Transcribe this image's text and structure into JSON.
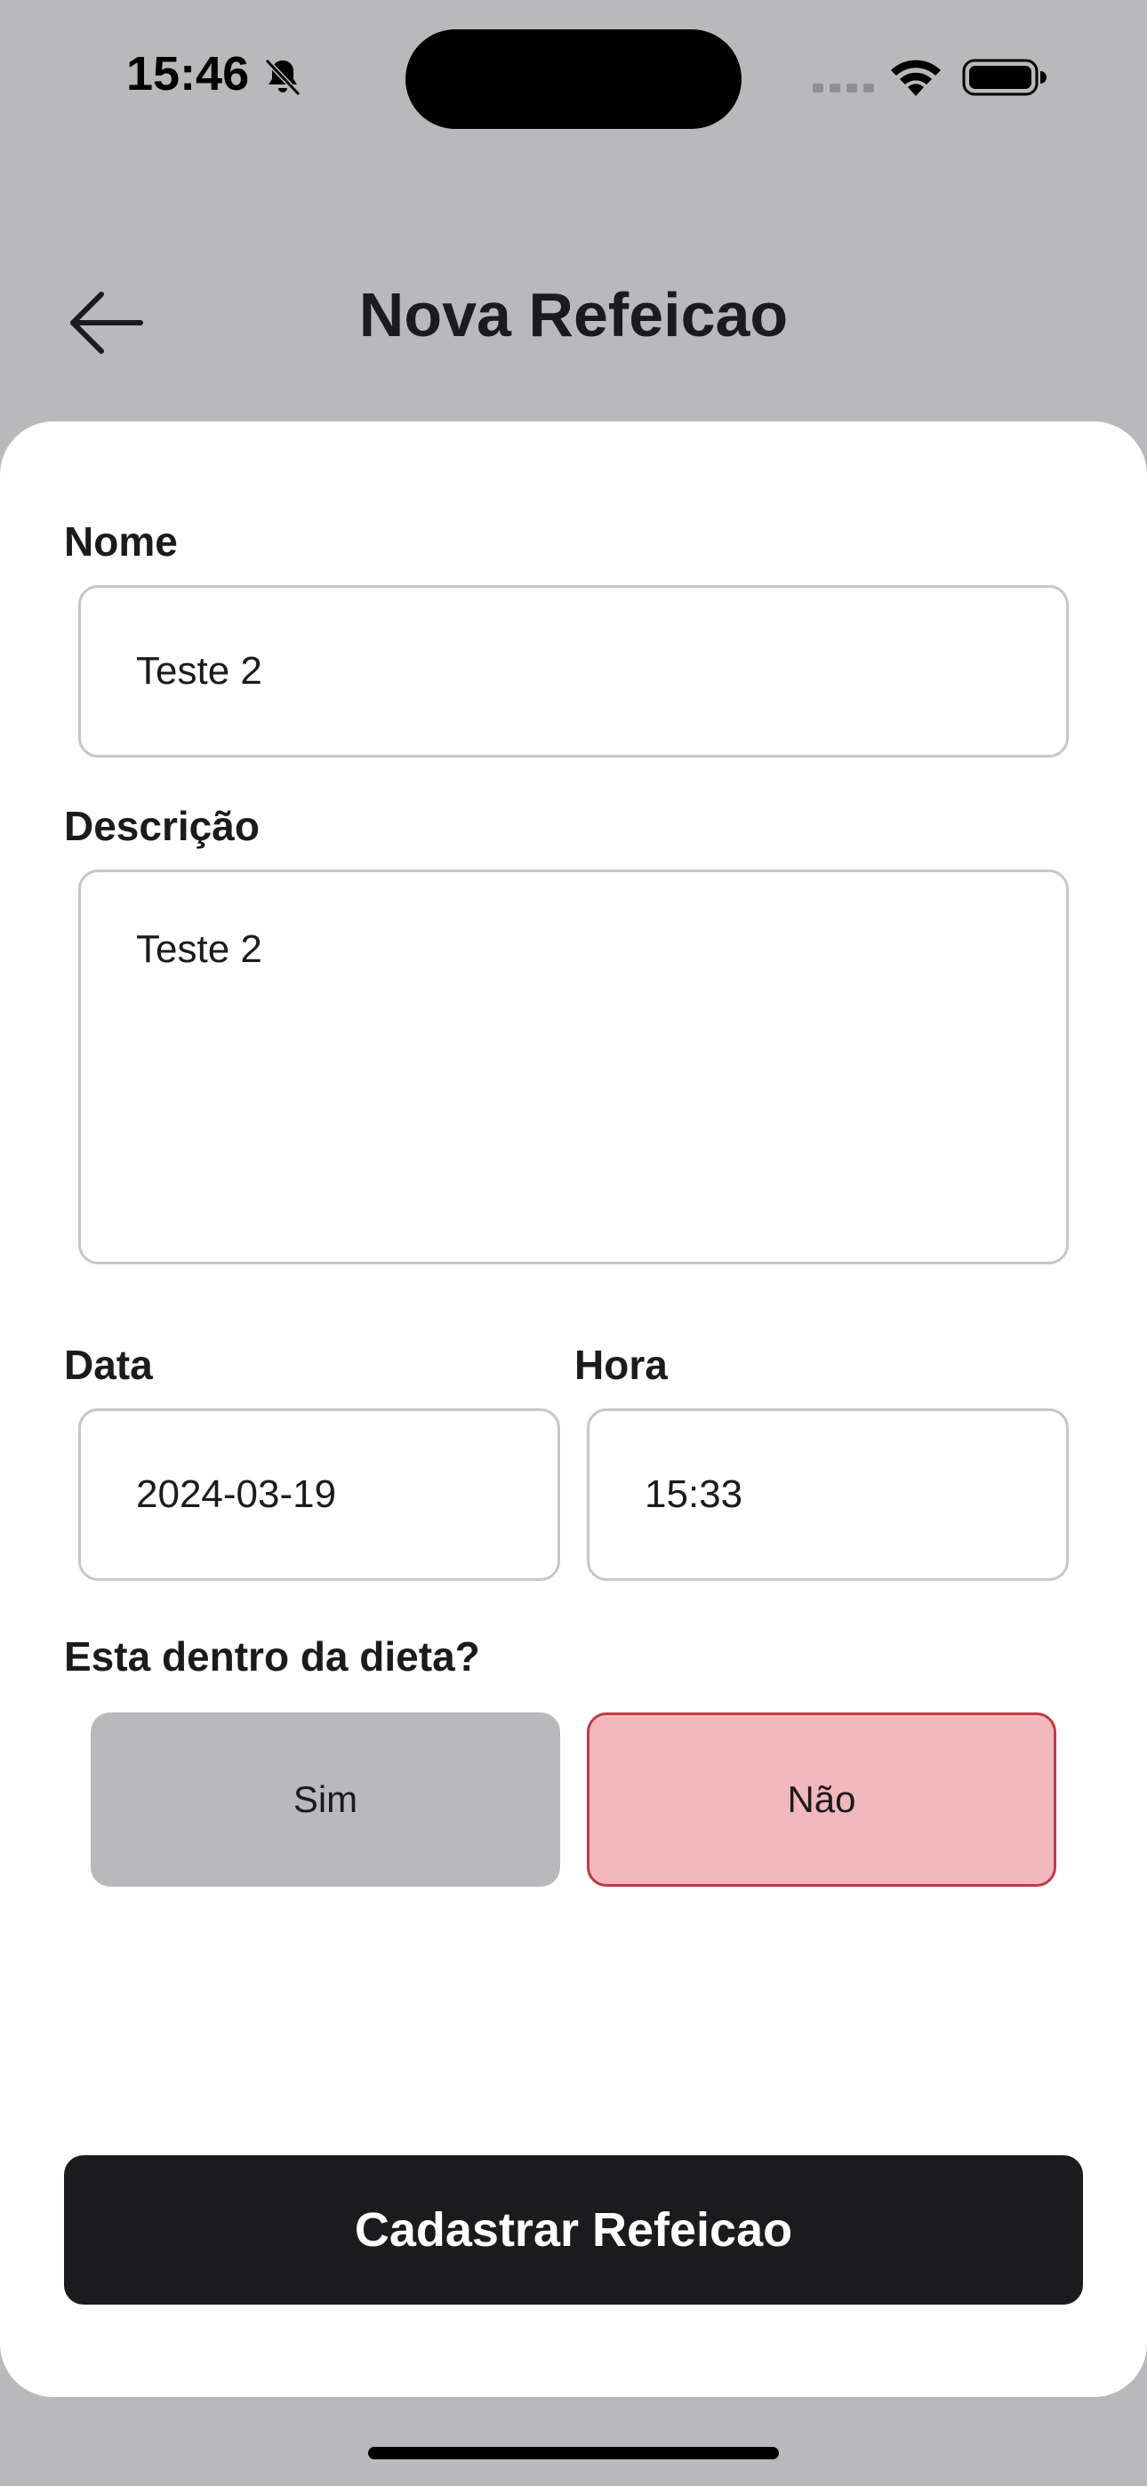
{
  "status_bar": {
    "time": "15:46",
    "icons": [
      "bell-slash-icon",
      "signal-icon",
      "wifi-icon",
      "battery-icon"
    ]
  },
  "header": {
    "title": "Nova Refeicao",
    "back_icon": "arrow-left-icon"
  },
  "form": {
    "name_label": "Nome",
    "name_value": "Teste 2",
    "description_label": "Descrição",
    "description_value": "Teste 2",
    "date_label": "Data",
    "date_value": "2024-03-19",
    "time_label": "Hora",
    "time_value": "15:33",
    "diet_question": "Esta dentro da dieta?",
    "diet_yes_label": "Sim",
    "diet_no_label": "Não",
    "diet_selected": "Não",
    "submit_label": "Cadastrar Refeicao"
  },
  "colors": {
    "background": "#B8B9BB",
    "sheet": "#FFFFFF",
    "text": "#1B1B1D",
    "no_selected_fill": "#F3B8BC",
    "no_selected_border": "#BF3B44",
    "yes_fill": "#B8B9BB",
    "submit_fill": "#1B1B1D"
  }
}
